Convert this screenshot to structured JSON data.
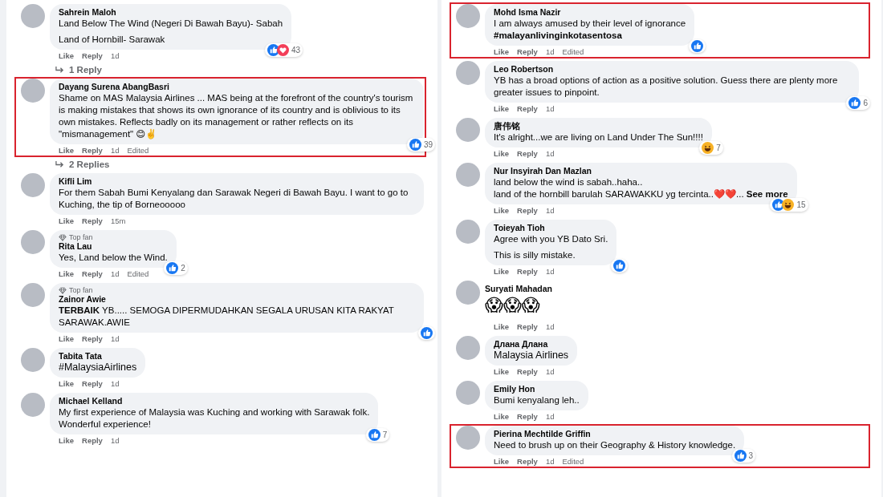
{
  "columns": [
    {
      "comments": [
        {
          "author": "Sahrein Maloh",
          "highlighted": false,
          "body": [
            {
              "kind": "plain",
              "text": "Land Below The Wind (Negeri Di Bawah Bayu)- Sabah"
            },
            {
              "kind": "plain",
              "text": "Land of Hornbill- Sarawak"
            }
          ],
          "reactions": {
            "icons": [
              {
                "kind": "like"
              },
              {
                "kind": "love"
              }
            ],
            "count": "43"
          },
          "actions": {
            "like": "Like",
            "reply": "Reply",
            "time": "1d"
          },
          "replies_link": "1 Reply"
        },
        {
          "author": "Dayang Surena AbangBasri",
          "highlighted": true,
          "body": [
            {
              "kind": "plain",
              "text": "Shame on MAS Malaysia Airlines ... MAS being at the forefront of the country's tourism is making mistakes that shows its own ignorance of its country and is oblivious to its own mistakes. Reflects badly on its management or rather reflects on its \"mismanagement\" 😊✌️"
            }
          ],
          "reactions": {
            "icons": [
              {
                "kind": "like"
              }
            ],
            "count": "39"
          },
          "actions": {
            "like": "Like",
            "reply": "Reply",
            "time": "1d",
            "edited": "Edited"
          },
          "replies_link": "2 Replies"
        },
        {
          "author": "Kifli Lim",
          "highlighted": false,
          "body": [
            {
              "kind": "plain",
              "text": "For them Sabah Bumi Kenyalang dan Sarawak Negeri di Bawah Bayu. I want to go to Kuching, the tip of Borneooooo"
            }
          ],
          "actions": {
            "like": "Like",
            "reply": "Reply",
            "time": "15m"
          }
        },
        {
          "author": "Rita Lau",
          "badge": "Top fan",
          "highlighted": false,
          "body": [
            {
              "kind": "plain",
              "text": "Yes, Land below the Wind."
            }
          ],
          "reactions": {
            "icons": [
              {
                "kind": "like"
              }
            ],
            "count": "2"
          },
          "actions": {
            "like": "Like",
            "reply": "Reply",
            "time": "1d",
            "edited": "Edited"
          }
        },
        {
          "author": "Zainor Awie",
          "badge": "Top fan",
          "highlighted": false,
          "body": [
            {
              "kind": "plain",
              "text": "**TERBAIK** YB..... SEMOGA DIPERMUDAHKAN SEGALA URUSAN KITA RAKYAT SARAWAK.AWIE"
            }
          ],
          "reactions": {
            "icons": [
              {
                "kind": "like"
              }
            ]
          },
          "actions": {
            "like": "Like",
            "reply": "Reply",
            "time": "1d"
          }
        },
        {
          "author": "Tabita Tata",
          "highlighted": false,
          "body": [
            {
              "kind": "tag",
              "text": "#MalaysiaAirlines"
            }
          ],
          "actions": {
            "like": "Like",
            "reply": "Reply",
            "time": "1d"
          }
        },
        {
          "author": "Michael Kelland",
          "highlighted": false,
          "body": [
            {
              "kind": "plain",
              "text": "My first experience of Malaysia was Kuching and working with Sarawak folk.\nWonderful experience!"
            }
          ],
          "reactions": {
            "icons": [
              {
                "kind": "like"
              }
            ],
            "count": "7"
          },
          "actions": {
            "like": "Like",
            "reply": "Reply",
            "time": "1d"
          }
        }
      ]
    },
    {
      "comments": [
        {
          "author": "Mohd Isma Nazir",
          "highlighted": true,
          "body": [
            {
              "kind": "plain",
              "text": "I am always amused by their level of ignorance"
            },
            {
              "kind": "hashtag",
              "text": "#malayanlivinginkotasentosa"
            }
          ],
          "reactions": {
            "icons": [
              {
                "kind": "like"
              }
            ]
          },
          "actions": {
            "like": "Like",
            "reply": "Reply",
            "time": "1d",
            "edited": "Edited"
          }
        },
        {
          "author": "Leo Robertson",
          "highlighted": false,
          "body": [
            {
              "kind": "plain",
              "text": "YB has a broad options of action as a positive solution. Guess there are plenty more greater issues to pinpoint."
            }
          ],
          "reactions": {
            "icons": [
              {
                "kind": "like"
              }
            ],
            "count": "6"
          },
          "actions": {
            "like": "Like",
            "reply": "Reply",
            "time": "1d"
          }
        },
        {
          "author": "唐伟铭",
          "highlighted": false,
          "body": [
            {
              "kind": "plain",
              "text": "It's alright...we are living on Land Under The Sun!!!!"
            }
          ],
          "reactions": {
            "icons": [
              {
                "kind": "haha"
              }
            ],
            "count": "7"
          },
          "actions": {
            "like": "Like",
            "reply": "Reply",
            "time": "1d"
          }
        },
        {
          "author": "Nur Insyirah Dan Mazlan",
          "highlighted": false,
          "body": [
            {
              "kind": "plain",
              "text": "land below the wind is sabah..haha..\nland of the hornbill barulah SARAWAKKU yg tercinta..❤️❤️..."
            }
          ],
          "see_more": "See more",
          "reactions": {
            "icons": [
              {
                "kind": "like"
              },
              {
                "kind": "haha"
              }
            ],
            "count": "15"
          },
          "actions": {
            "like": "Like",
            "reply": "Reply",
            "time": "1d"
          }
        },
        {
          "author": "Toieyah Tioh",
          "highlighted": false,
          "body": [
            {
              "kind": "plain",
              "text": "Agree with you YB Dato Sri."
            },
            {
              "kind": "plain",
              "text": "This is silly mistake."
            }
          ],
          "reactions": {
            "icons": [
              {
                "kind": "like"
              }
            ]
          },
          "actions": {
            "like": "Like",
            "reply": "Reply",
            "time": "1d"
          }
        },
        {
          "author": "Suryati Mahadan",
          "highlighted": false,
          "body": [
            {
              "kind": "emoji",
              "text": "😱😱😱"
            }
          ],
          "actions": {
            "like": "Like",
            "reply": "Reply",
            "time": "1d"
          }
        },
        {
          "author": "Длана Длана",
          "highlighted": false,
          "body": [
            {
              "kind": "tag",
              "text": "Malaysia Airlines"
            }
          ],
          "actions": {
            "like": "Like",
            "reply": "Reply",
            "time": "1d"
          }
        },
        {
          "author": "Emily Hon",
          "highlighted": false,
          "body": [
            {
              "kind": "plain",
              "text": "Bumi kenyalang leh.."
            }
          ],
          "actions": {
            "like": "Like",
            "reply": "Reply",
            "time": "1d"
          }
        },
        {
          "author": "Pierina Mechtilde Griffin",
          "highlighted": true,
          "body": [
            {
              "kind": "plain",
              "text": "Need to brush up on their Geography & History knowledge."
            }
          ],
          "reactions": {
            "icons": [
              {
                "kind": "like"
              }
            ],
            "count": "3"
          },
          "actions": {
            "like": "Like",
            "reply": "Reply",
            "time": "1d",
            "edited": "Edited"
          }
        }
      ]
    }
  ]
}
